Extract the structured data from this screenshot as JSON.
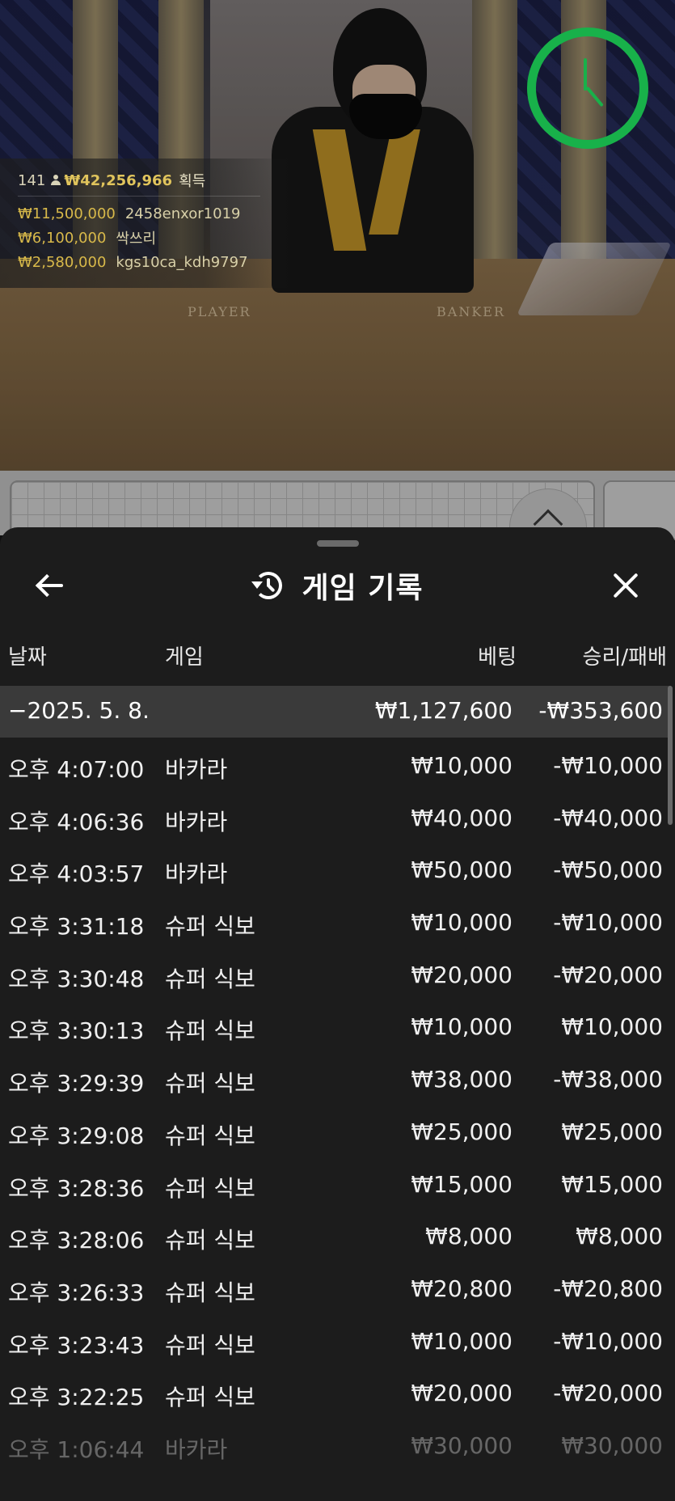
{
  "live": {
    "table_labels": {
      "player": "PLAYER",
      "banker": "BANKER"
    },
    "winners": {
      "count": "141",
      "total": "₩42,256,966",
      "suffix": "획득",
      "list": [
        {
          "amount": "₩11,500,000",
          "name": "2458enxor1019"
        },
        {
          "amount": "₩6,100,000",
          "name": "싹쓰리"
        },
        {
          "amount": "₩2,580,000",
          "name": "kgs10ca_kdh9797"
        }
      ]
    },
    "timer": {
      "icon": "clock-timer-icon",
      "color": "#18b14a"
    }
  },
  "sheet": {
    "title": "게임 기록",
    "back_icon": "arrow-left-icon",
    "title_icon": "history-icon",
    "close_icon": "close-icon",
    "columns": {
      "date": "날짜",
      "game": "게임",
      "bet": "베팅",
      "result": "승리/패배"
    },
    "date_group": {
      "date": "−2025. 5. 8.",
      "bet": "₩1,127,600",
      "result": "-₩353,600"
    },
    "rows": [
      {
        "time": "오후 4:07:00",
        "game": "바카라",
        "bet": "₩10,000",
        "result": "-₩10,000"
      },
      {
        "time": "오후 4:06:36",
        "game": "바카라",
        "bet": "₩40,000",
        "result": "-₩40,000"
      },
      {
        "time": "오후 4:03:57",
        "game": "바카라",
        "bet": "₩50,000",
        "result": "-₩50,000"
      },
      {
        "time": "오후 3:31:18",
        "game": "슈퍼 식보",
        "bet": "₩10,000",
        "result": "-₩10,000"
      },
      {
        "time": "오후 3:30:48",
        "game": "슈퍼 식보",
        "bet": "₩20,000",
        "result": "-₩20,000"
      },
      {
        "time": "오후 3:30:13",
        "game": "슈퍼 식보",
        "bet": "₩10,000",
        "result": "₩10,000"
      },
      {
        "time": "오후 3:29:39",
        "game": "슈퍼 식보",
        "bet": "₩38,000",
        "result": "-₩38,000"
      },
      {
        "time": "오후 3:29:08",
        "game": "슈퍼 식보",
        "bet": "₩25,000",
        "result": "₩25,000"
      },
      {
        "time": "오후 3:28:36",
        "game": "슈퍼 식보",
        "bet": "₩15,000",
        "result": "₩15,000"
      },
      {
        "time": "오후 3:28:06",
        "game": "슈퍼 식보",
        "bet": "₩8,000",
        "result": "₩8,000"
      },
      {
        "time": "오후 3:26:33",
        "game": "슈퍼 식보",
        "bet": "₩20,800",
        "result": "-₩20,800"
      },
      {
        "time": "오후 3:23:43",
        "game": "슈퍼 식보",
        "bet": "₩10,000",
        "result": "-₩10,000"
      },
      {
        "time": "오후 3:22:25",
        "game": "슈퍼 식보",
        "bet": "₩20,000",
        "result": "-₩20,000"
      },
      {
        "time": "오후 1:06:44",
        "game": "바카라",
        "bet": "₩30,000",
        "result": "₩30,000"
      }
    ]
  },
  "colors": {
    "accent_gold": "#d8b94a",
    "sheet_bg": "#1c1c1c",
    "date_row_bg": "#3a3a3a",
    "timer_green": "#18b14a"
  }
}
